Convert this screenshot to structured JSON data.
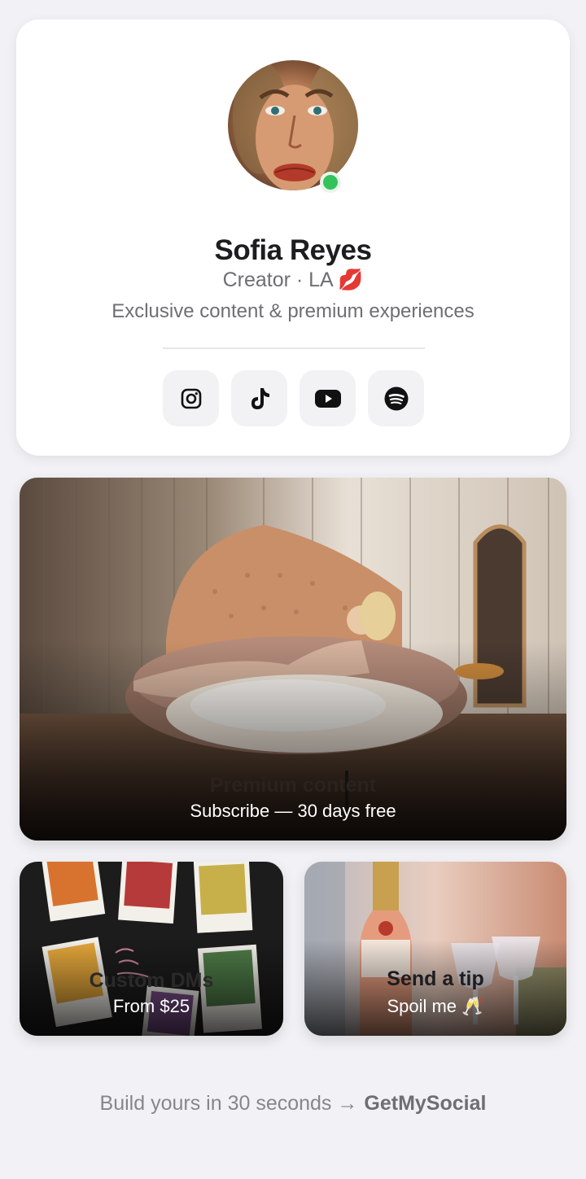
{
  "profile": {
    "name": "Sofia Reyes",
    "subtitle": "Creator · LA 💋",
    "bio": "Exclusive content & premium experiences",
    "status": "online",
    "status_color": "#33c35a"
  },
  "socials": [
    {
      "icon": "instagram-icon"
    },
    {
      "icon": "tiktok-icon"
    },
    {
      "icon": "youtube-icon"
    },
    {
      "icon": "spotify-icon"
    }
  ],
  "tiles": {
    "premium": {
      "title": "Premium content",
      "subtitle": "Subscribe — 30 days free"
    },
    "dms": {
      "title": "Custom DMs",
      "subtitle": "From $25"
    },
    "tip": {
      "title": "Send a tip",
      "subtitle": "Spoil me 🥂"
    }
  },
  "footer": {
    "text": "Build yours in 30 seconds →",
    "brand": "GetMySocial"
  }
}
